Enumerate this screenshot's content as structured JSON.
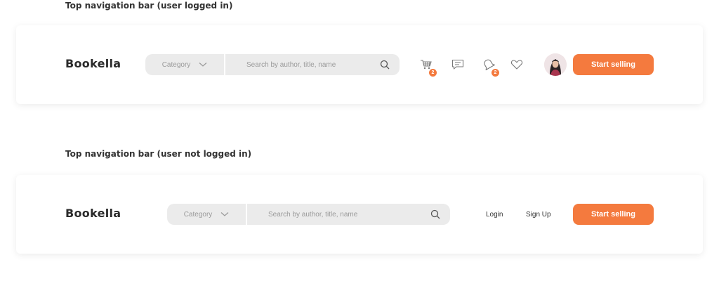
{
  "sections": [
    {
      "label": "Top navigation bar (user logged in)",
      "logo": "Bookella",
      "search": {
        "category": "Category",
        "placeholder": "Search by author, title, name"
      },
      "icons": [
        {
          "name": "cart-icon",
          "badge": "2"
        },
        {
          "name": "message-icon"
        },
        {
          "name": "bell-icon",
          "badge": "2"
        },
        {
          "name": "heart-icon"
        }
      ],
      "cta": "Start selling"
    },
    {
      "label": "Top navigation bar (user not logged in)",
      "logo": "Bookella",
      "search": {
        "category": "Category",
        "placeholder": "Search by author, title, name"
      },
      "login": "Login",
      "signup": "Sign Up",
      "cta": "Start selling"
    }
  ],
  "colors": {
    "accent": "#f47a3e",
    "search_bg": "#ebebeb",
    "text": "#2b2b2b",
    "muted": "#9a9a9a"
  }
}
